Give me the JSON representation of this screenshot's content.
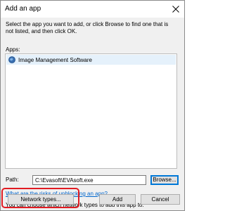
{
  "window": {
    "title": "Add an app"
  },
  "dialog": {
    "description": "Select the app you want to add, or click Browse to find one that is not listed, and then click OK.",
    "apps_label": "Apps:",
    "apps": [
      {
        "name": "Image Management Software",
        "icon": "app-globe-icon",
        "selected": true
      }
    ],
    "path_label": "Path:",
    "path_value": "C:\\Evasoft\\EVAsoft.exe",
    "browse_label": "Browse...",
    "risk_link": "What are the risks of unblocking an app?",
    "network_info": "You can choose which network types to add this app to.",
    "network_types_label": "Network types...",
    "add_label": "Add",
    "cancel_label": "Cancel"
  },
  "colors": {
    "accent": "#0078d7",
    "highlight": "#e11b22",
    "link": "#0066cc",
    "selection": "#e5f1fb"
  }
}
